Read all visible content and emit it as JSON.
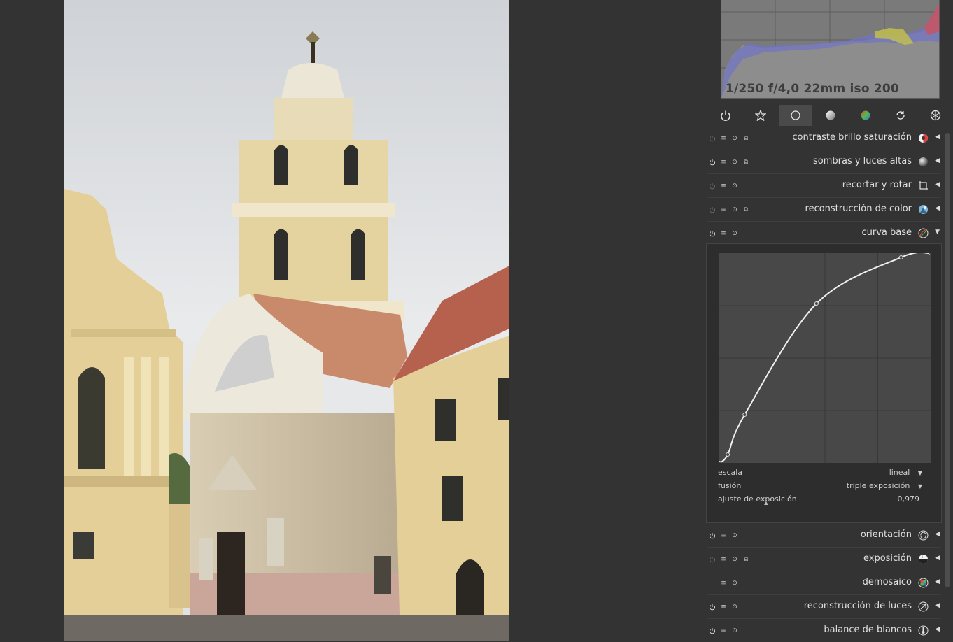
{
  "histogram": {
    "exif": "1/250 f/4,0 22mm iso 200"
  },
  "module_groups": [
    {
      "name": "power",
      "active": false
    },
    {
      "name": "favorites",
      "active": false
    },
    {
      "name": "basic",
      "active": true
    },
    {
      "name": "tone",
      "active": false
    },
    {
      "name": "color",
      "active": false
    },
    {
      "name": "correct",
      "active": false
    },
    {
      "name": "effect",
      "active": false
    }
  ],
  "modules": [
    {
      "label": "contraste brillo saturación",
      "icon": "color-contrast-icon"
    },
    {
      "label": "sombras y luces altas",
      "icon": "sphere-icon"
    },
    {
      "label": "recortar y rotar",
      "icon": "crop-icon"
    },
    {
      "label": "reconstrucción de color",
      "icon": "color-recon-icon"
    },
    {
      "label": "curva base",
      "icon": "curve-icon"
    },
    {
      "label": "orientación",
      "icon": "rotate-icon"
    },
    {
      "label": "exposición",
      "icon": "exposure-icon"
    },
    {
      "label": "demosaico",
      "icon": "demosaic-icon"
    },
    {
      "label": "reconstrucción de luces",
      "icon": "highlight-icon"
    },
    {
      "label": "balance de blancos",
      "icon": "thermometer-icon"
    }
  ],
  "curve_base": {
    "scale_label": "escala",
    "scale_value": "lineal",
    "fusion_label": "fusión",
    "fusion_value": "triple exposición",
    "exposure_label": "ajuste de exposición",
    "exposure_value": "0,979",
    "exposure_fraction": 0.24,
    "curve_points": [
      [
        0,
        0
      ],
      [
        0.04,
        0.04
      ],
      [
        0.12,
        0.23
      ],
      [
        0.46,
        0.76
      ],
      [
        0.86,
        0.98
      ],
      [
        1,
        1
      ]
    ]
  }
}
